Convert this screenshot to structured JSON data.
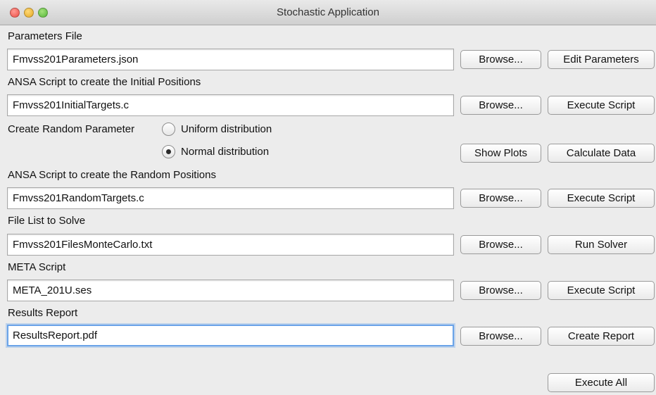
{
  "window": {
    "title": "Stochastic Application"
  },
  "parameters": {
    "label": "Parameters File",
    "value": "Fmvss201Parameters.json",
    "browse": "Browse...",
    "action": "Edit Parameters"
  },
  "initial": {
    "label": "ANSA Script to create the Initial Positions",
    "value": "Fmvss201InitialTargets.c",
    "browse": "Browse...",
    "action": "Execute Script"
  },
  "random_param": {
    "label": "Create Random Parameter",
    "uniform": {
      "label": "Uniform distribution",
      "selected": false
    },
    "normal": {
      "label": "Normal distribution",
      "selected": true
    },
    "show_plots": "Show Plots",
    "calculate": "Calculate Data"
  },
  "random": {
    "label": "ANSA Script to create the Random Positions",
    "value": "Fmvss201RandomTargets.c",
    "browse": "Browse...",
    "action": "Execute Script"
  },
  "solve": {
    "label": "File List to Solve",
    "value": "Fmvss201FilesMonteCarlo.txt",
    "browse": "Browse...",
    "action": "Run Solver"
  },
  "meta": {
    "label": "META Script",
    "value": "META_201U.ses",
    "browse": "Browse...",
    "action": "Execute Script"
  },
  "report": {
    "label": "Results Report",
    "value": "ResultsReport.pdf",
    "browse": "Browse...",
    "action": "Create Report"
  },
  "execute_all": "Execute All"
}
